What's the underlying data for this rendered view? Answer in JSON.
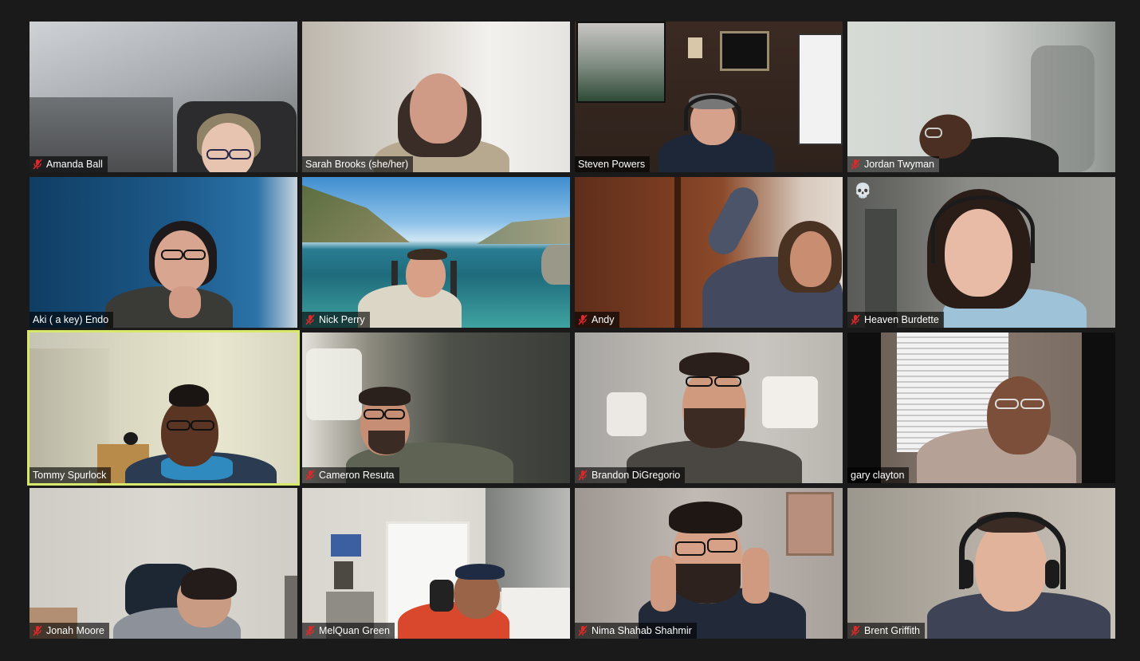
{
  "participants": [
    {
      "name": "Amanda Ball",
      "muted": true
    },
    {
      "name": "Sarah Brooks (she/her)",
      "muted": false
    },
    {
      "name": "Steven Powers",
      "muted": false
    },
    {
      "name": "Jordan Twyman",
      "muted": true
    },
    {
      "name": "Aki ( a key) Endo",
      "muted": false
    },
    {
      "name": "Nick Perry",
      "muted": true
    },
    {
      "name": "Andy",
      "muted": true
    },
    {
      "name": "Heaven Burdette",
      "muted": true,
      "reaction": "💀"
    },
    {
      "name": "Tommy Spurlock",
      "muted": false,
      "active_speaker": true
    },
    {
      "name": "Cameron Resuta",
      "muted": true
    },
    {
      "name": "Brandon DiGregorio",
      "muted": true
    },
    {
      "name": "gary clayton",
      "muted": false
    },
    {
      "name": "Jonah Moore",
      "muted": true
    },
    {
      "name": "MelQuan Green",
      "muted": true
    },
    {
      "name": "Nima Shahab Shahmir",
      "muted": true
    },
    {
      "name": "Brent Griffith",
      "muted": true
    }
  ],
  "colors": {
    "background": "#1a1a1a",
    "active_speaker_border": "#d7e86a",
    "mute_icon": "#e02828",
    "nameplate_text": "#ffffff"
  },
  "icons": {
    "mute": "microphone-muted-icon",
    "reaction": "skull-icon"
  }
}
